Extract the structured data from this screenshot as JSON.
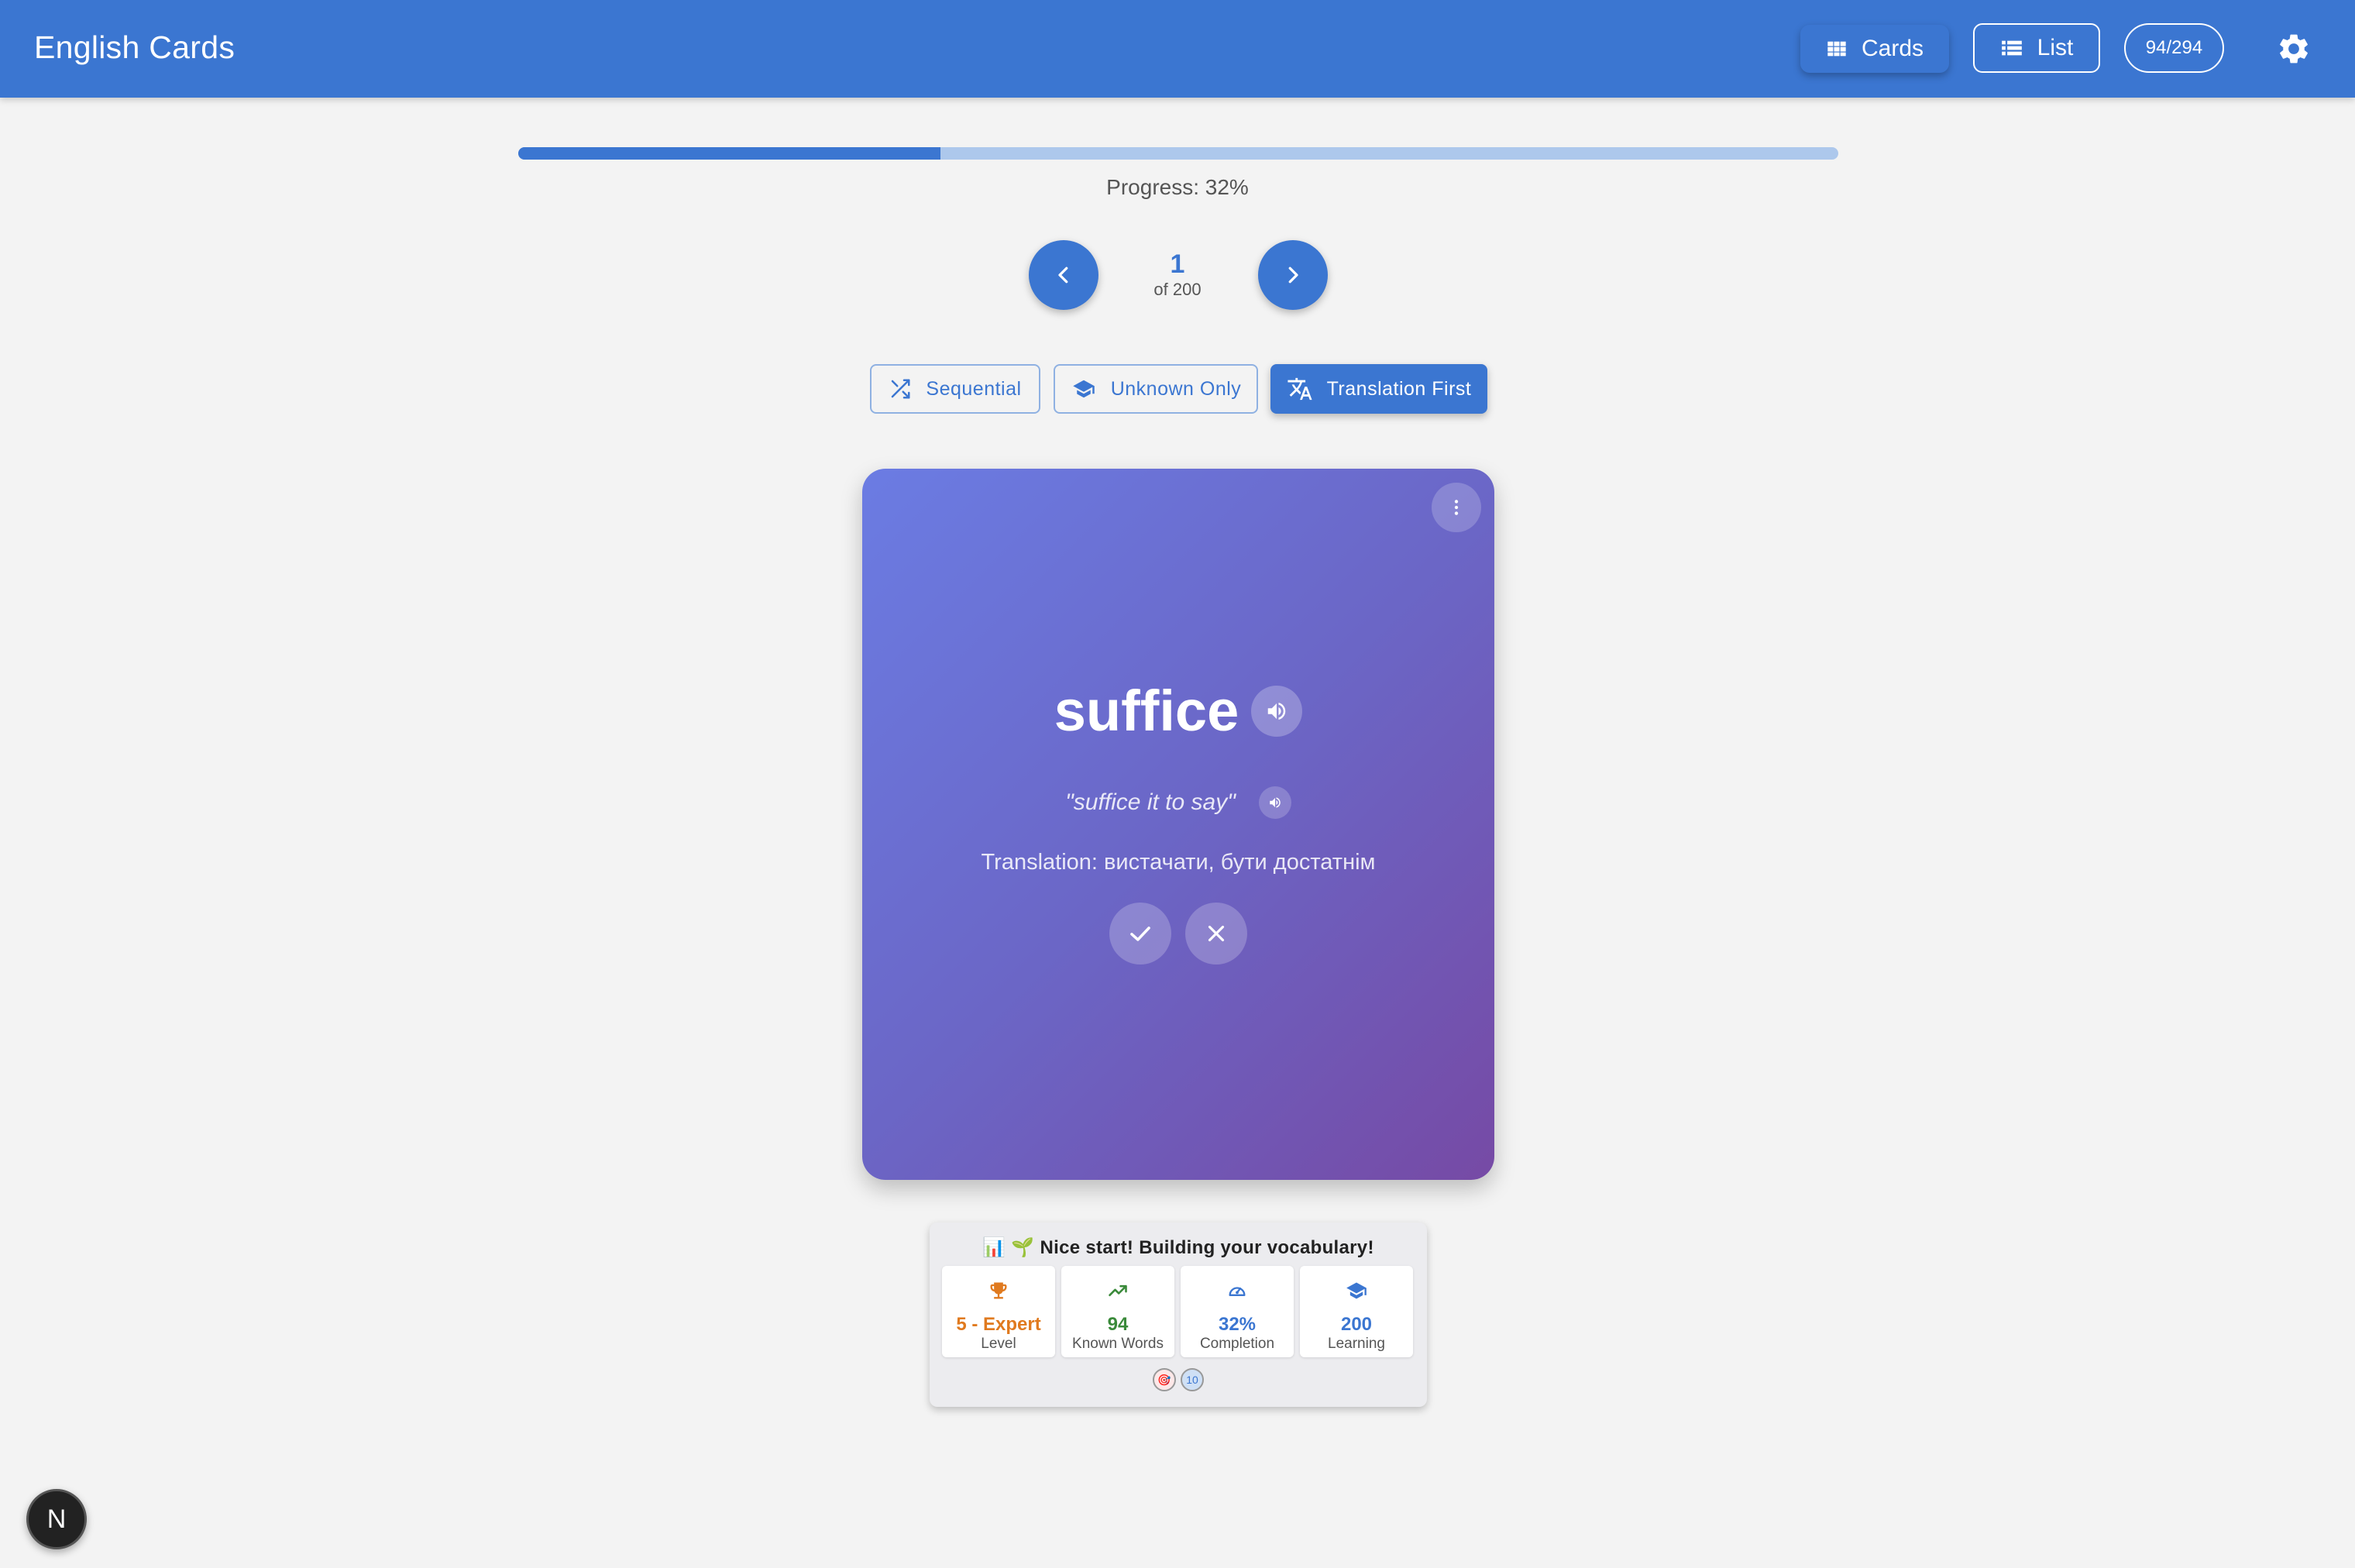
{
  "app": {
    "title": "English Cards"
  },
  "header": {
    "cards_label": "Cards",
    "list_label": "List",
    "count": "94/294"
  },
  "progress": {
    "label": "Progress: 32%",
    "fraction": 0.32
  },
  "navigation": {
    "current": "1",
    "total_label": "of 200"
  },
  "modes": {
    "sequential": "Sequential",
    "unknown_only": "Unknown Only",
    "translation_first": "Translation First",
    "active": "translation_first"
  },
  "card": {
    "word": "suffice",
    "example": "\"suffice it to say\"",
    "translation": "Translation: вистачати, бути достатнім"
  },
  "stats": {
    "header": "📊 🌱 Nice start! Building your vocabulary!",
    "tiles": [
      {
        "value": "5 - Expert",
        "label": "Level",
        "color": "#e07a1f",
        "icon": "trophy-icon"
      },
      {
        "value": "94",
        "label": "Known Words",
        "color": "#3a8a3a",
        "icon": "trending-up-icon"
      },
      {
        "value": "32%",
        "label": "Completion",
        "color": "#3b76d1",
        "icon": "speedometer-icon"
      },
      {
        "value": "200",
        "label": "Learning",
        "color": "#3b76d1",
        "icon": "graduation-cap-icon"
      }
    ],
    "badges": [
      "🎯",
      "10"
    ]
  },
  "dev": {
    "badge": "N"
  },
  "colors": {
    "primary": "#3b76d1",
    "background": "#f3f3f3"
  }
}
